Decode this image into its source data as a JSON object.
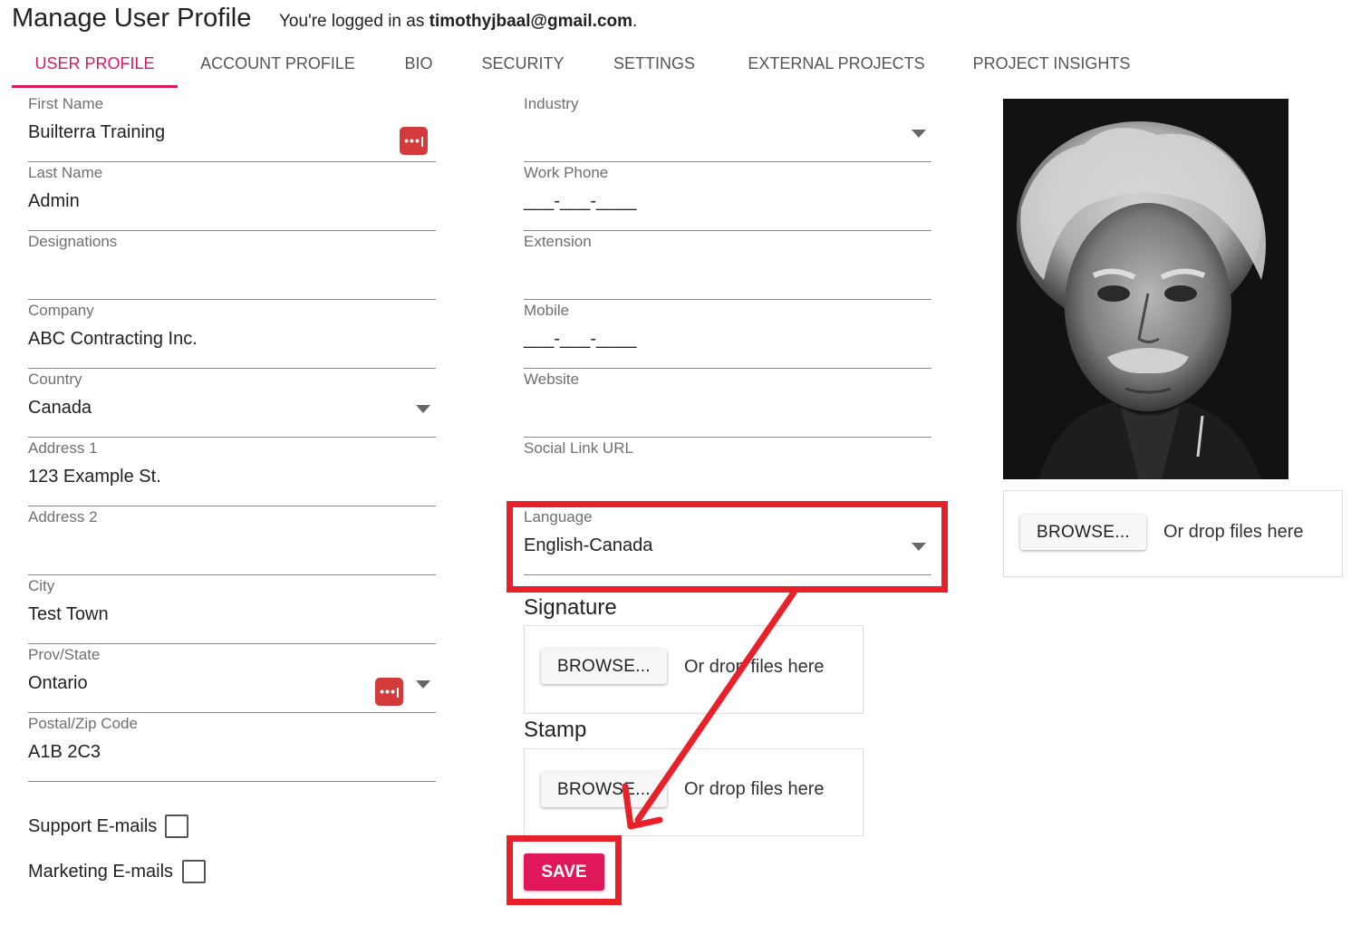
{
  "header": {
    "title": "Manage User Profile",
    "logged_in_prefix": "You're logged in as ",
    "user_email": "timothyjbaal@gmail.com",
    "logged_in_suffix": "."
  },
  "tabs": [
    {
      "label": "USER PROFILE",
      "active": true
    },
    {
      "label": "ACCOUNT PROFILE",
      "active": false
    },
    {
      "label": "BIO",
      "active": false
    },
    {
      "label": "SECURITY",
      "active": false
    },
    {
      "label": "SETTINGS",
      "active": false
    },
    {
      "label": "EXTERNAL PROJECTS",
      "active": false
    },
    {
      "label": "PROJECT INSIGHTS",
      "active": false
    }
  ],
  "left_fields": {
    "first_name": {
      "label": "First Name",
      "value": "Builterra Training"
    },
    "last_name": {
      "label": "Last Name",
      "value": "Admin"
    },
    "designations": {
      "label": "Designations",
      "value": ""
    },
    "company": {
      "label": "Company",
      "value": "ABC Contracting Inc."
    },
    "country": {
      "label": "Country",
      "value": "Canada"
    },
    "address1": {
      "label": "Address 1",
      "value": "123 Example St."
    },
    "address2": {
      "label": "Address 2",
      "value": ""
    },
    "city": {
      "label": "City",
      "value": "Test Town"
    },
    "prov_state": {
      "label": "Prov/State",
      "value": "Ontario"
    },
    "postal": {
      "label": "Postal/Zip Code",
      "value": "A1B 2C3"
    }
  },
  "checkboxes": {
    "support": {
      "label": "Support E-mails",
      "checked": false
    },
    "marketing": {
      "label": "Marketing E-mails",
      "checked": false
    }
  },
  "middle_fields": {
    "industry": {
      "label": "Industry",
      "value": ""
    },
    "work_phone": {
      "label": "Work Phone",
      "value": "___-___-____"
    },
    "extension": {
      "label": "Extension",
      "value": ""
    },
    "mobile": {
      "label": "Mobile",
      "value": "___-___-____"
    },
    "website": {
      "label": "Website",
      "value": ""
    },
    "social": {
      "label": "Social Link URL",
      "value": ""
    },
    "language": {
      "label": "Language",
      "value": "English-Canada"
    }
  },
  "signature": {
    "title": "Signature",
    "browse_label": "BROWSE...",
    "drop_text": "Or drop files here"
  },
  "stamp": {
    "title": "Stamp",
    "browse_label": "BROWSE...",
    "drop_text": "Or drop files here"
  },
  "photo_upload": {
    "browse_label": "BROWSE...",
    "drop_text": "Or drop files here"
  },
  "save_label": "SAVE",
  "colors": {
    "accent": "#e0185a",
    "annotation_red": "#e8202a",
    "more_button": "#d33a3a"
  },
  "icons": {
    "more": "more-dots-icon",
    "dropdown": "caret-down-icon"
  }
}
